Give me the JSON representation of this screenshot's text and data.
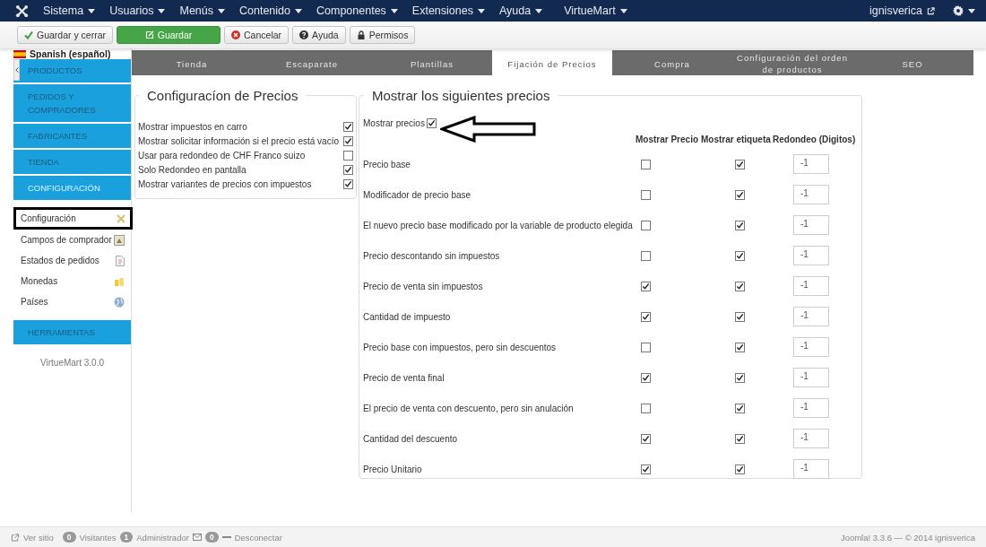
{
  "top_menu": {
    "items": [
      {
        "label": "Sistema"
      },
      {
        "label": "Usuarios"
      },
      {
        "label": "Menús"
      },
      {
        "label": "Contenido"
      },
      {
        "label": "Componentes"
      },
      {
        "label": "Extensiones"
      },
      {
        "label": "Ayuda"
      },
      {
        "label": "VirtueMart"
      }
    ],
    "user": "ignisverica"
  },
  "toolbar": {
    "buttons": [
      {
        "label": "Guardar y cerrar",
        "kind": "check"
      },
      {
        "label": "Guardar",
        "kind": "primary"
      },
      {
        "label": "Cancelar",
        "kind": "cancel"
      },
      {
        "label": "Ayuda",
        "kind": "help"
      },
      {
        "label": "Permisos",
        "kind": "lock"
      }
    ]
  },
  "sidebar": {
    "language": "Spanish (español)",
    "items": [
      {
        "label": "PRODUCTOS",
        "kind": "section",
        "selected": false
      },
      {
        "label": "PEDIDOS Y COMPRADORES",
        "kind": "section",
        "selected": false
      },
      {
        "label": "FABRICANTES",
        "kind": "section",
        "selected": false
      },
      {
        "label": "TIENDA",
        "kind": "section",
        "selected": false
      },
      {
        "label": "CONFIGURACIÓN",
        "kind": "section",
        "selected": true
      },
      {
        "label": "Configuración",
        "kind": "link",
        "selected": true
      },
      {
        "label": "Campos de comprador",
        "kind": "link",
        "selected": false
      },
      {
        "label": "Estados de pedidos",
        "kind": "link",
        "selected": false
      },
      {
        "label": "Monedas",
        "kind": "link",
        "selected": false
      },
      {
        "label": "Países",
        "kind": "link",
        "selected": false
      },
      {
        "label": "HERRAMIENTAS",
        "kind": "section",
        "selected": false
      }
    ],
    "version": "VirtueMart 3.0.0"
  },
  "tabs": [
    {
      "label": "Tienda",
      "selected": false
    },
    {
      "label": "Escaparate",
      "selected": false
    },
    {
      "label": "Plantillas",
      "selected": false
    },
    {
      "label": "Fijación de Precios",
      "selected": true
    },
    {
      "label": "Compra",
      "selected": false
    },
    {
      "label": "Configuración del orden de productos",
      "selected": false
    },
    {
      "label": "SEO",
      "selected": false
    }
  ],
  "price_config": {
    "title": "Configuracíon de Precios",
    "options": [
      {
        "label": "Mostrar impuestos en carro",
        "checked": true
      },
      {
        "label": "Mostrar solicitar información si el precio está vacío",
        "checked": true
      },
      {
        "label": "Usar para redondeo de CHF Franco suizo",
        "checked": false
      },
      {
        "label": "Solo Redondeo en pantalla",
        "checked": true
      },
      {
        "label": "Mostrar variantes de precios con impuestos",
        "checked": true
      }
    ]
  },
  "display_prices": {
    "title": "Mostrar los siguientes precios",
    "show_prices": {
      "label": "Mostrar precios",
      "checked": true
    },
    "columns": [
      "Mostrar Precio",
      "Mostrar etiqueta",
      "Redondeo (Digitos)"
    ],
    "rows": [
      {
        "label": "Precio base",
        "show_price": false,
        "show_label": true,
        "rounding": "-1"
      },
      {
        "label": "Modificador de precio base",
        "show_price": false,
        "show_label": true,
        "rounding": "-1"
      },
      {
        "label": "El nuevo precio base modificado por la variable de producto elegida",
        "show_price": false,
        "show_label": true,
        "rounding": "-1"
      },
      {
        "label": "Precio descontando sin impuestos",
        "show_price": false,
        "show_label": true,
        "rounding": "-1"
      },
      {
        "label": "Precio de venta sin impuestos",
        "show_price": true,
        "show_label": true,
        "rounding": "-1"
      },
      {
        "label": "Cantidad de impuesto",
        "show_price": true,
        "show_label": true,
        "rounding": "-1"
      },
      {
        "label": "Precio base con impuestos, pero sin descuentos",
        "show_price": false,
        "show_label": true,
        "rounding": "-1"
      },
      {
        "label": "Precio de venta final",
        "show_price": true,
        "show_label": true,
        "rounding": "-1"
      },
      {
        "label": "El precio de venta con descuento, pero sin anulación",
        "show_price": false,
        "show_label": true,
        "rounding": "-1"
      },
      {
        "label": "Cantidad del descuento",
        "show_price": true,
        "show_label": true,
        "rounding": "-1"
      },
      {
        "label": "Precio Unitario",
        "show_price": true,
        "show_label": true,
        "rounding": "-1"
      }
    ]
  },
  "footer": {
    "view_site": "Ver sitio",
    "visitors_count": "0",
    "visitors": "Visitantes",
    "admins_count": "1",
    "admins": "Administrador",
    "messages_count": "0",
    "logout": "Desconectar",
    "version": "Joomla! 3.3.6 — © 2014 ignisverica"
  }
}
